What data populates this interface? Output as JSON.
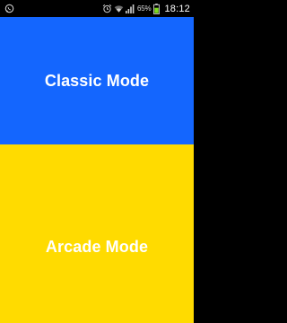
{
  "status_bar": {
    "icons": {
      "left": "whatsapp-icon",
      "alarm": "alarm-icon",
      "wifi": "wifi-icon",
      "signal": "signal-icon",
      "battery": "battery-icon"
    },
    "battery_percent": "65%",
    "time": "18:12"
  },
  "modes": {
    "classic": {
      "label": "Classic Mode",
      "color": "#1466fe"
    },
    "arcade": {
      "label": "Arcade Mode",
      "color": "#ffdb00"
    }
  }
}
